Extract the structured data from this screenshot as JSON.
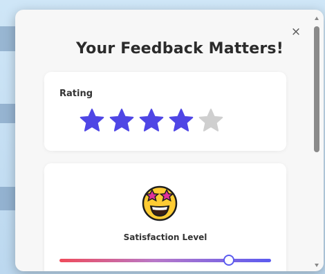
{
  "modal": {
    "title": "Your Feedback Matters!",
    "close_label": "×"
  },
  "rating": {
    "label": "Rating",
    "value": 4,
    "max": 5,
    "filled_color": "#4f46e5",
    "empty_color": "#cfcfcf"
  },
  "satisfaction": {
    "emoji": "star-struck-face-icon",
    "label": "Satisfaction Level",
    "slider_value": 0.8,
    "gradient_colors": [
      "#ef4b5b",
      "#b878c8",
      "#5b5bf0"
    ]
  }
}
